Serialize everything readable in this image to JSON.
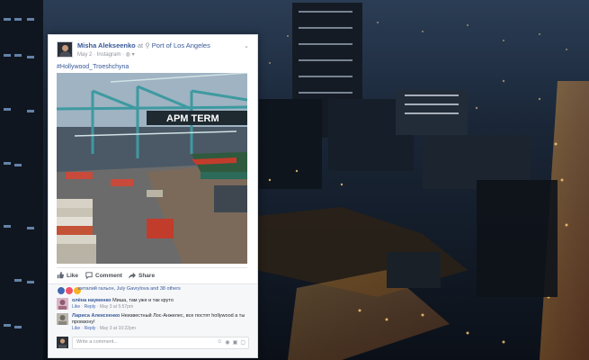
{
  "post": {
    "author": "Misha Alekseenko",
    "location_prefix": "at",
    "location": "Port of Los Angeles",
    "date": "May 2",
    "via": "Instagram",
    "privacy_icon": "globe-icon",
    "hashtag": "#Hollywood_Troeshchyna",
    "photo_sign": "APM TERM"
  },
  "actions": {
    "like": "Like",
    "comment": "Comment",
    "share": "Share"
  },
  "reactions": {
    "summary": "виталий гальон, July Gavrylova and 38 others"
  },
  "comments": [
    {
      "author": "олёна науменко",
      "text": "Миша, там уже и так круто",
      "like": "Like",
      "reply": "Reply",
      "time": "May 3 at 5:57pm"
    },
    {
      "author": "Лариса Алексеенко",
      "text": "Неизвестный Лос-Анжелес, все постят hollywood а ты промзону!",
      "like": "Like",
      "reply": "Reply",
      "time": "May 3 at 10:22pm"
    }
  ],
  "composer": {
    "placeholder": "Write a comment..."
  },
  "colors": {
    "link": "#365899",
    "like": "#4267b2",
    "love": "#f25268",
    "haha": "#f7b125"
  }
}
